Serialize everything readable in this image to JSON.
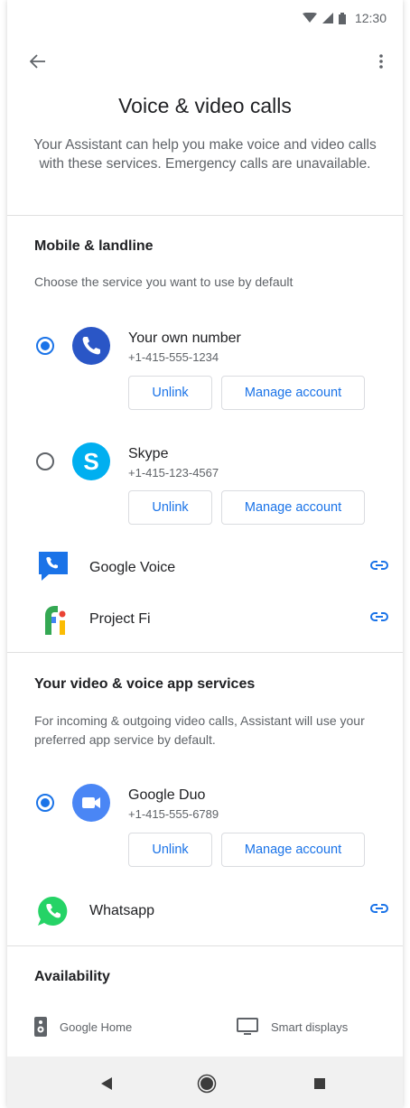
{
  "status_bar": {
    "time": "12:30"
  },
  "header": {
    "title": "Voice & video calls",
    "description": "Your Assistant can help you make voice and video calls with these services. Emergency calls are unavailable."
  },
  "mobile": {
    "title": "Mobile & landline",
    "subtitle": "Choose the service you want to use by default",
    "services": [
      {
        "name": "Your own number",
        "number": "+1-415-555-1234",
        "selected": true,
        "icon": "phone-icon",
        "unlink": "Unlink",
        "manage": "Manage account"
      },
      {
        "name": "Skype",
        "number": "+1-415-123-4567",
        "selected": false,
        "icon": "skype-icon",
        "unlink": "Unlink",
        "manage": "Manage account"
      }
    ],
    "apps": [
      {
        "name": "Google Voice",
        "icon": "google-voice-icon"
      },
      {
        "name": "Project Fi",
        "icon": "project-fi-icon"
      }
    ]
  },
  "video": {
    "title": "Your video & voice app services",
    "subtitle": "For incoming & outgoing video calls, Assistant will use your preferred app service by default.",
    "services": [
      {
        "name": "Google Duo",
        "number": "+1-415-555-6789",
        "selected": true,
        "icon": "google-duo-icon",
        "unlink": "Unlink",
        "manage": "Manage account"
      }
    ],
    "apps": [
      {
        "name": "Whatsapp",
        "icon": "whatsapp-icon"
      }
    ]
  },
  "availability": {
    "title": "Availability",
    "items": [
      {
        "label": "Google Home",
        "icon": "speaker-icon"
      },
      {
        "label": "Smart displays",
        "icon": "display-icon"
      }
    ]
  },
  "colors": {
    "accent": "#1a73e8",
    "text": "#202124",
    "secondary": "#5f6368"
  }
}
